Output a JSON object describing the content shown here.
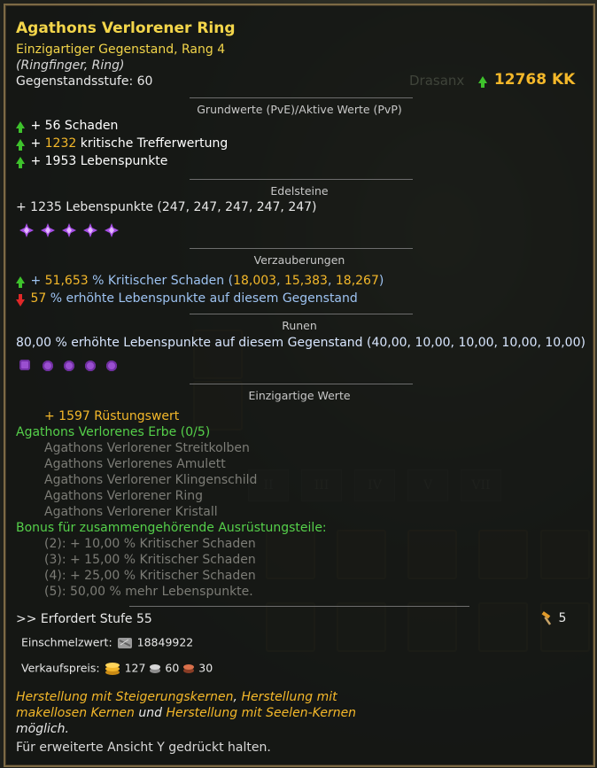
{
  "item": {
    "name": "Agathons Verlorener Ring",
    "rarity_line": "Einzigartiger Gegenstand, Rang 4",
    "slot_line": "(Ringfinger, Ring)",
    "level_line": "Gegenstandsstufe: 60",
    "player_name": "Drasanx",
    "kk_value": "12768 KK"
  },
  "sections": {
    "base": "Grundwerte (PvE)/Aktive Werte (PvP)",
    "gems": "Edelsteine",
    "enchant": "Verzauberungen",
    "runes": "Runen",
    "unique": "Einzigartige Werte"
  },
  "base_stats": [
    {
      "prefix": "+ ",
      "value": "56",
      "label": " Schaden",
      "value_color": "white"
    },
    {
      "prefix": "+ ",
      "value": "1232",
      "label": " kritische Trefferwertung",
      "value_color": "orange"
    },
    {
      "prefix": "+ ",
      "value": "1953",
      "label": " Lebenspunkte",
      "value_color": "white"
    }
  ],
  "gems": {
    "text": "+ 1235 Lebenspunkte (247, 247, 247, 247, 247)",
    "icons": [
      "purple-gem-icon",
      "purple-gem-icon",
      "purple-gem-icon",
      "purple-gem-icon",
      "purple-gem-icon"
    ]
  },
  "enchant": {
    "line1": {
      "prefix": "+ ",
      "value": "51,653",
      "mid": " % Kritischer Schaden (",
      "v1": "18,003",
      "sep1": ", ",
      "v2": "15,383",
      "sep2": ", ",
      "v3": "18,267",
      "end": ")"
    },
    "line2": {
      "value": "57",
      "text": " % erhöhte Lebenspunkte auf diesem Gegenstand"
    }
  },
  "runes": {
    "text": "80,00 % erhöhte Lebenspunkte auf diesem Gegenstand (40,00, 10,00, 10,00, 10,00, 10,00)",
    "icons": [
      "rune-icon",
      "rune-icon",
      "rune-icon",
      "rune-icon",
      "rune-icon"
    ]
  },
  "unique": {
    "armor": "+ 1597 Rüstungswert",
    "set_name": "Agathons Verlorenes Erbe (0/5)",
    "set_items": [
      "Agathons Verlorener Streitkolben",
      "Agathons Verlorenes Amulett",
      "Agathons Verlorener Klingenschild",
      "Agathons Verlorener Ring",
      "Agathons Verlorener Kristall"
    ],
    "bonus_title": "Bonus für zusammengehörende Ausrüstungsteile:",
    "bonuses": [
      "(2): + 10,00 % Kritischer Schaden",
      "(3): + 15,00 % Kritischer Schaden",
      "(4): + 25,00 % Kritischer Schaden",
      "(5): 50,00 % mehr Lebenspunkte."
    ]
  },
  "footer": {
    "requires": ">> Erfordert Stufe 55",
    "hammer_count": "5",
    "melt_label": "Einschmelzwert:",
    "melt_value": "18849922",
    "sell_label": "Verkaufspreis:",
    "sell_gold": "127",
    "sell_silver": "60",
    "sell_copper": "30",
    "craft_a": "Herstellung mit Steigerungskernen",
    "craft_comma": ", ",
    "craft_b": "Herstellung mit",
    "craft_c": "makellosen Kernen",
    "craft_und": " und ",
    "craft_d": "Herstellung mit Seelen-Kernen",
    "craft_e": "möglich.",
    "hint": "Für erweiterte Ansicht Y gedrückt halten."
  },
  "colors": {
    "gold": "#f3d54a",
    "orange": "#f4b82a",
    "blue": "#9ec3f2",
    "green": "#55d04a",
    "grey": "#7c7c76",
    "border": "#7d6a45"
  }
}
